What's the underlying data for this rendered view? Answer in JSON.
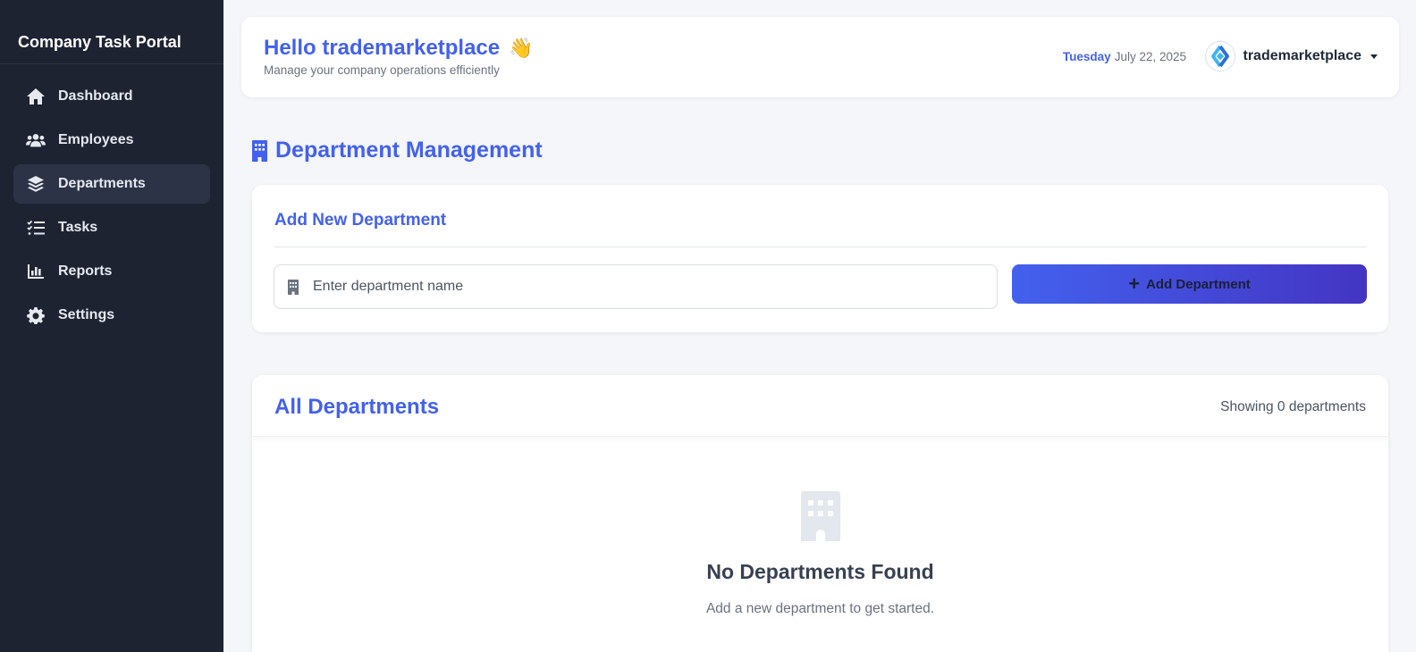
{
  "sidebar": {
    "brand": "Company Task Portal",
    "items": [
      {
        "label": "Dashboard",
        "icon": "home-icon"
      },
      {
        "label": "Employees",
        "icon": "users-icon"
      },
      {
        "label": "Departments",
        "icon": "layers-icon",
        "active": true
      },
      {
        "label": "Tasks",
        "icon": "tasks-icon"
      },
      {
        "label": "Reports",
        "icon": "chart-icon"
      },
      {
        "label": "Settings",
        "icon": "gear-icon"
      }
    ]
  },
  "header": {
    "greeting": "Hello trademarketplace",
    "greeting_emoji": "👋",
    "subtitle": "Manage your company operations efficiently",
    "day": "Tuesday",
    "date": "July 22, 2025",
    "username": "trademarketplace"
  },
  "page": {
    "title": "Department Management",
    "title_icon": "building-icon"
  },
  "add_form": {
    "title": "Add New Department",
    "input_value": "",
    "input_placeholder": "Enter department name",
    "button_label": "Add Department",
    "button_icon": "plus-icon"
  },
  "list": {
    "title": "All Departments",
    "count_text": "Showing 0 departments",
    "empty_icon": "building-icon",
    "empty_title": "No Departments Found",
    "empty_subtitle": "Add a new department to get started."
  },
  "colors": {
    "accent": "#4361ee",
    "sidebar_bg": "#1e2332",
    "button_gradient_end": "#4434c3"
  }
}
